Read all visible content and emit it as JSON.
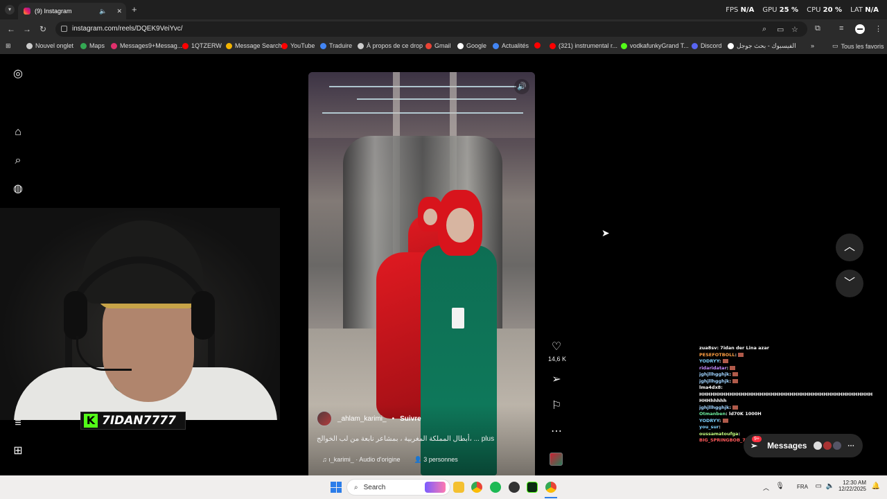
{
  "browser": {
    "tab_title": "(9) Instagram",
    "tab_mute_icon": "🔈",
    "tab_close": "✕",
    "new_tab": "+",
    "url": "instagram.com/reels/DQEK9VeiYvc/",
    "perf": {
      "fps_label": "FPS",
      "fps_value": "N/A",
      "gpu_label": "GPU",
      "gpu_value": "25",
      "cpu_label": "CPU",
      "cpu_value": "20",
      "lat_label": "LAT",
      "lat_value": "N/A"
    },
    "bookmarks": [
      {
        "label": "Nouvel onglet",
        "icon": "globe-icon",
        "color": "#cccccc"
      },
      {
        "label": "Maps",
        "icon": "maps-icon",
        "color": "#34a853"
      },
      {
        "label": "Messages9+Messag...",
        "icon": "instagram-icon",
        "color": "#e1306c"
      },
      {
        "label": "1QTZERW",
        "icon": "youtube-icon",
        "color": "#ff0000"
      },
      {
        "label": "Message Search",
        "icon": "bars-icon",
        "color": "#f4b400"
      },
      {
        "label": "YouTube",
        "icon": "youtube-icon",
        "color": "#ff0000"
      },
      {
        "label": "Traduire",
        "icon": "translate-icon",
        "color": "#4285f4"
      },
      {
        "label": "À propos de ce drop",
        "icon": "globe-icon",
        "color": "#cccccc"
      },
      {
        "label": "Gmail",
        "icon": "gmail-icon",
        "color": "#ea4335"
      },
      {
        "label": "Google",
        "icon": "google-icon",
        "color": "#ffffff"
      },
      {
        "label": "Actualités",
        "icon": "news-icon",
        "color": "#4285f4"
      },
      {
        "label": "",
        "icon": "youtube-icon",
        "color": "#ff0000"
      },
      {
        "label": "(321) instrumental r...",
        "icon": "youtube-icon",
        "color": "#ff0000"
      },
      {
        "label": "vodkafunkyGrand T...",
        "icon": "kick-icon",
        "color": "#53fc18"
      },
      {
        "label": "Discord",
        "icon": "discord-icon",
        "color": "#5865f2"
      },
      {
        "label": "الفيسبوك - بحث جوجل",
        "icon": "google-icon",
        "color": "#ffffff"
      }
    ],
    "bookmarks_more": "»",
    "all_bookmarks": "Tous les favoris"
  },
  "instagram": {
    "sidebar_badges": {
      "messages": "9+"
    },
    "reel": {
      "author": "_ahlam_karimi_",
      "separator": "•",
      "follow": "Suivre",
      "caption": "أبطال المملكة المغربية ، بمشاعر نابعة من لب الخوالج، ... plus",
      "audio": "ı_karimi_ · Audio d'origine",
      "people": "3 personnes"
    },
    "actions": {
      "like_count": "14,6 K"
    },
    "messages": {
      "label": "Messages",
      "badge": "9+"
    }
  },
  "webcam": {
    "channel_name": "7IDAN7777",
    "logo_letter": "K"
  },
  "chat": [
    {
      "user": "zua8sv",
      "color": "#ffffff",
      "text": ": 7idan der Lina azar"
    },
    {
      "user": "PESEFOTBOLL",
      "color": "#ff9f43",
      "text": ":",
      "emote": true
    },
    {
      "user": "YODRYY",
      "color": "#7fd3ff",
      "text": ":",
      "emote": true
    },
    {
      "user": "ridaridatar",
      "color": "#c58cff",
      "text": ":",
      "emote": true
    },
    {
      "user": "jghjllhgghjk",
      "color": "#9fd3ff",
      "text": ":",
      "emote": true
    },
    {
      "user": "jghjllhgghjk",
      "color": "#9fd3ff",
      "text": ":",
      "emote": true
    },
    {
      "user": "lma4dx8",
      "color": "#ffffff",
      "text": ":"
    },
    {
      "user": "HHHHHHHHHHHHHHHHHHHHHHHHHHHHHHHHHHHHHHHHHHHHHHHHHH",
      "color": "#ffffff",
      "text": ""
    },
    {
      "user": "HHHhhhhh",
      "color": "#ffffff",
      "text": ""
    },
    {
      "user": "jghjllhgghjk",
      "color": "#9fd3ff",
      "text": ":",
      "emote": true
    },
    {
      "user": "Otmanben",
      "color": "#6ef0a0",
      "text": ": ld70K 1000H"
    },
    {
      "user": "YODRYY",
      "color": "#7fd3ff",
      "text": ":",
      "emote": true
    },
    {
      "user": "you_sur",
      "color": "#7fd3ff",
      "text": ":"
    },
    {
      "user": "oussamatoufga",
      "color": "#c5ff7f",
      "text": ":"
    },
    {
      "user": "BIG_SPRINGBOB_777",
      "color": "#ff5a5a",
      "text": ": go"
    }
  ],
  "taskbar": {
    "search": "Search",
    "lang": "FRA",
    "time": "12:30 AM",
    "date": "12/22/2025"
  }
}
